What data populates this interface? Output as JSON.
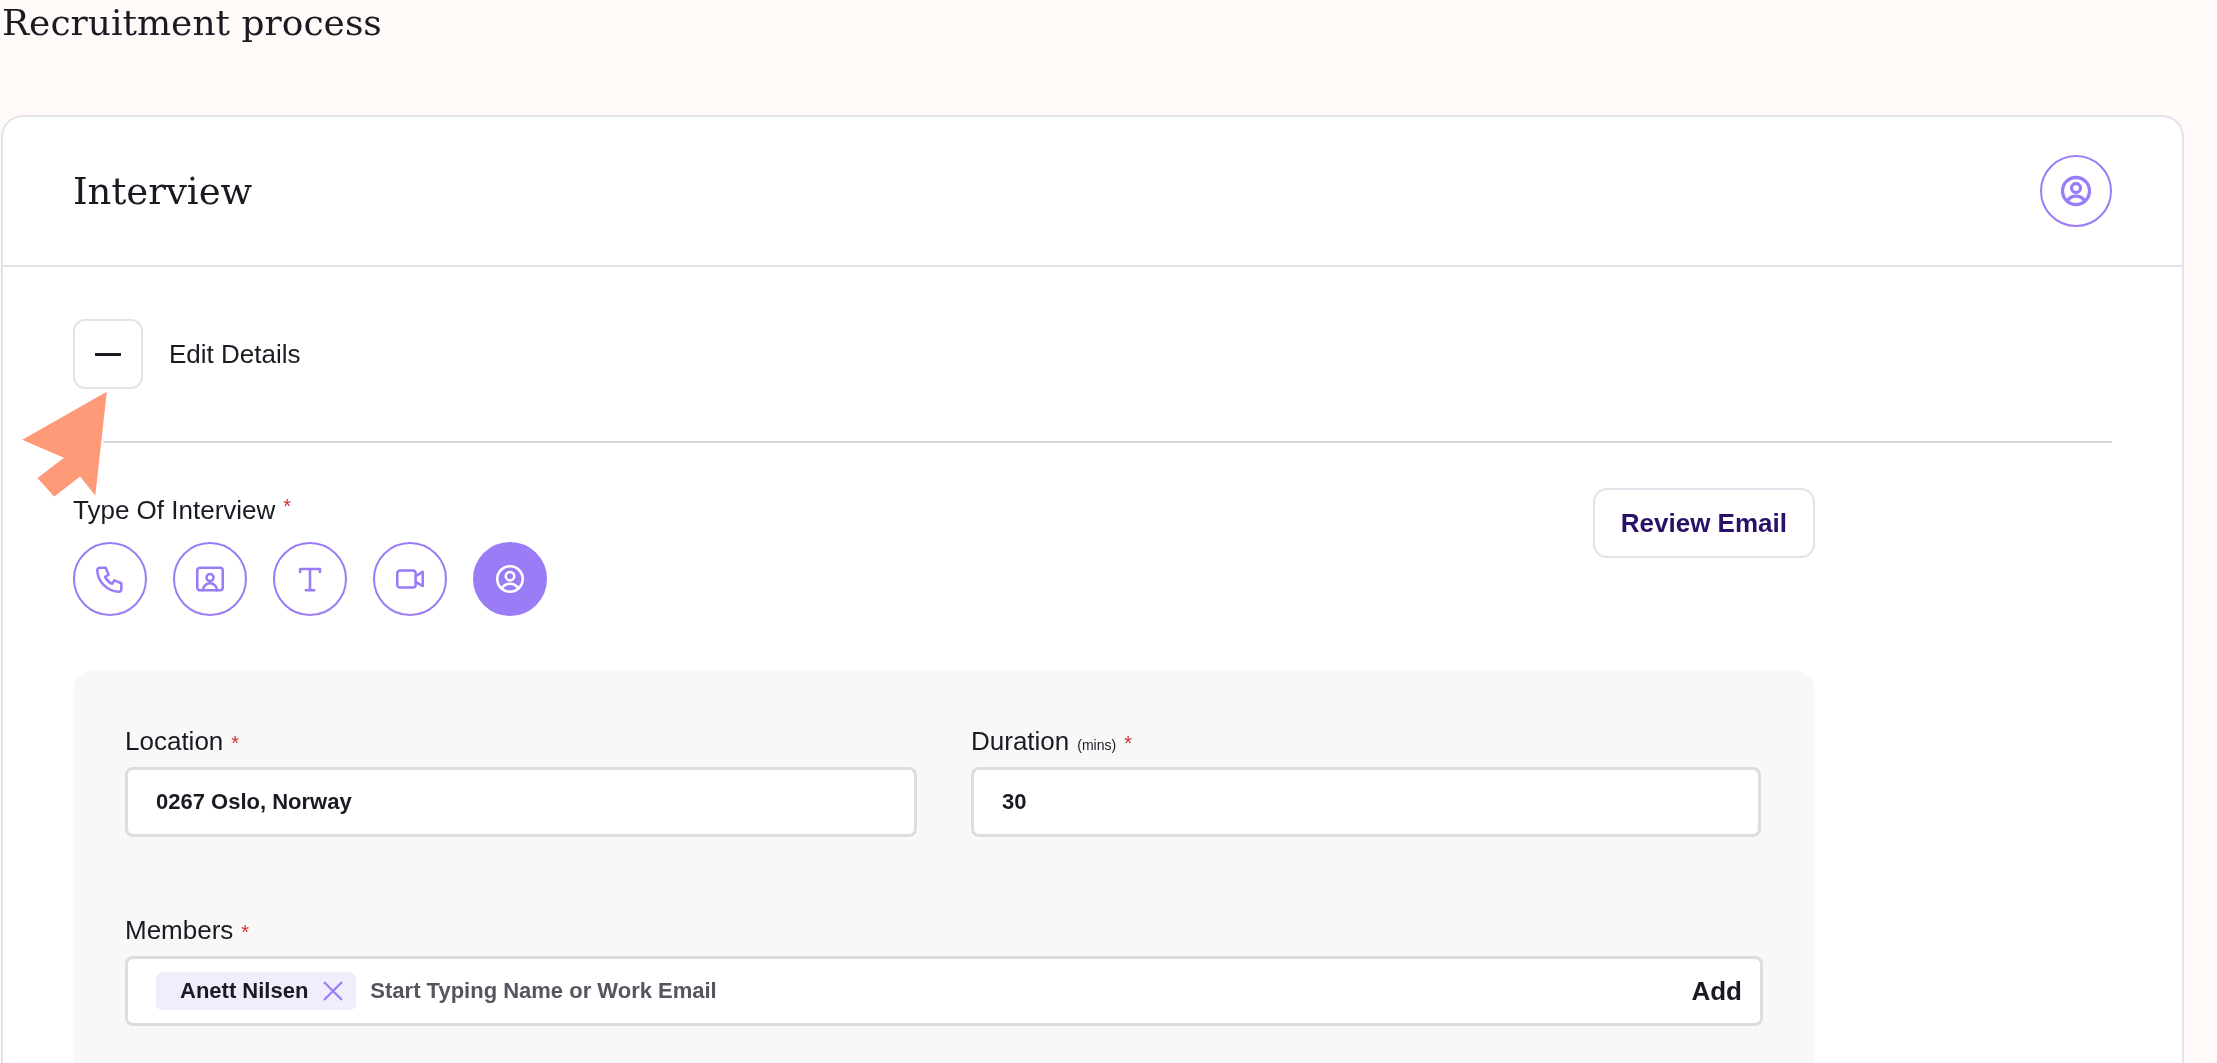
{
  "page_title": "Recruitment process",
  "card": {
    "title": "Interview"
  },
  "section": {
    "label": "Edit Details",
    "expanded": true
  },
  "interview_type": {
    "label": "Type Of Interview",
    "required_mark": "*",
    "options": [
      {
        "kind": "phone",
        "selected": false
      },
      {
        "kind": "photo",
        "selected": false
      },
      {
        "kind": "text",
        "selected": false
      },
      {
        "kind": "video",
        "selected": false
      },
      {
        "kind": "person",
        "selected": true
      }
    ]
  },
  "review_button": "Review Email",
  "location": {
    "label": "Location",
    "required_mark": "*",
    "value": "0267 Oslo, Norway"
  },
  "duration": {
    "label": "Duration",
    "hint": "(mins)",
    "required_mark": "*",
    "value": "30"
  },
  "members": {
    "label": "Members",
    "required_mark": "*",
    "chips": [
      {
        "name": "Anett Nilsen"
      }
    ],
    "placeholder": "Start Typing Name or Work Email",
    "add_label": "Add"
  }
}
